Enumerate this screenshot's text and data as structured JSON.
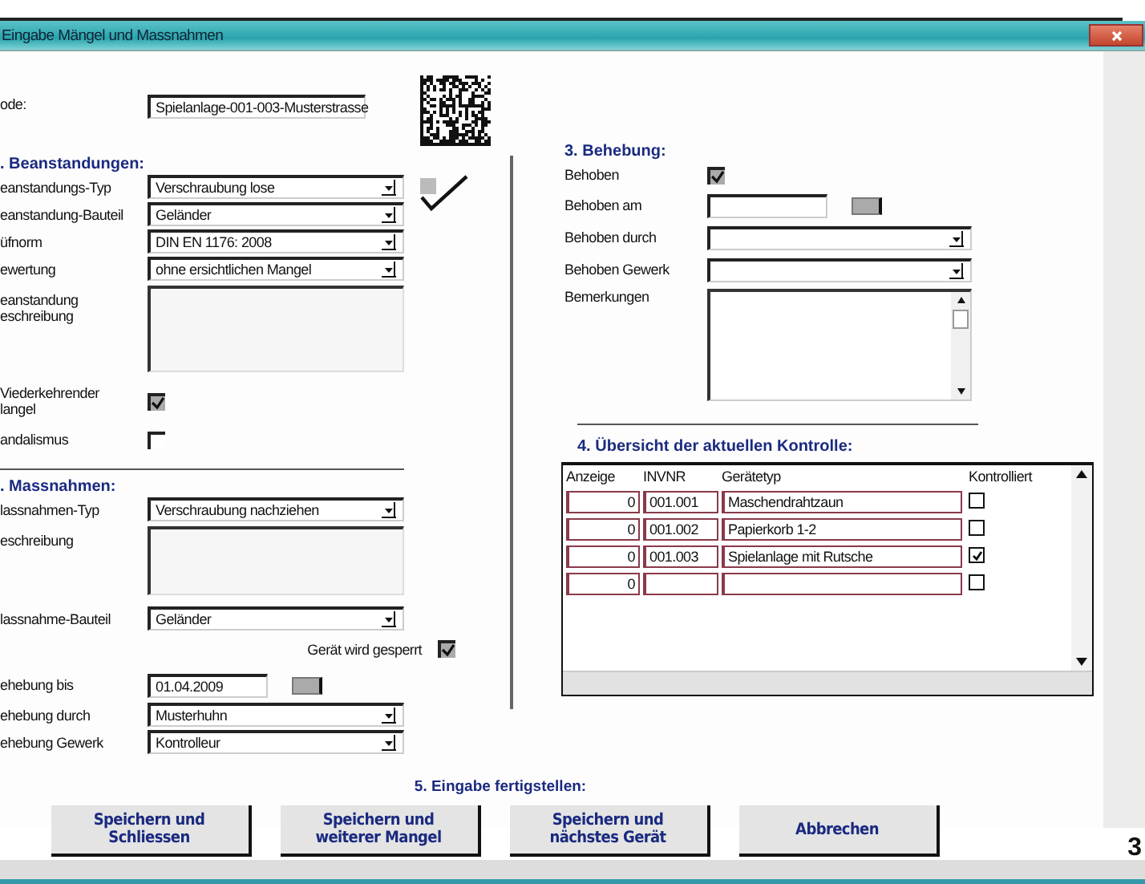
{
  "window": {
    "title": "Eingabe Mängel und Massnahmen"
  },
  "code": {
    "label": "ode:",
    "value": "Spielanlage-001-003-Musterstrasse"
  },
  "complaints": {
    "heading": ". Beanstandungen:",
    "fields": [
      {
        "kind": "dropdown",
        "label": "eanstandungs-Typ",
        "value": "Verschraubung lose"
      },
      {
        "kind": "dropdown",
        "label": "eanstandung-Bauteil",
        "value": "Geländer"
      },
      {
        "kind": "dropdown",
        "label": "üfnorm",
        "value": "DIN EN 1176: 2008"
      },
      {
        "kind": "dropdown",
        "label": "ewertung",
        "value": "ohne ersichtlichen Mangel"
      },
      {
        "kind": "textarea",
        "label": "eanstandung\neschreibung"
      },
      {
        "kind": "checkbox",
        "label": "Viederkehrender\nlangel",
        "checked": true
      },
      {
        "kind": "checkbox",
        "label": "andalismus",
        "checked": false
      }
    ]
  },
  "measures": {
    "heading": ". Massnahmen:",
    "fields": [
      {
        "kind": "dropdown",
        "label": "lassnahmen-Typ",
        "value": "Verschraubung nachziehen"
      },
      {
        "kind": "textarea",
        "label": "eschreibung"
      },
      {
        "kind": "dropdown",
        "label": "lassnahme-Bauteil",
        "value": "Geländer"
      },
      {
        "kind": "flag",
        "label": "Gerät wird gesperrt",
        "checked": true
      },
      {
        "kind": "date",
        "label": "ehebung bis",
        "value": "01.04.2009"
      },
      {
        "kind": "dropdown",
        "label": "ehebung durch",
        "value": "Musterhuhn"
      },
      {
        "kind": "dropdown",
        "label": "ehebung Gewerk",
        "value": "Kontrolleur"
      }
    ]
  },
  "repair": {
    "heading": "3. Behebung:",
    "fields": [
      {
        "kind": "checkbox",
        "label": "Behoben",
        "checked": true
      },
      {
        "kind": "date",
        "label": "Behoben am"
      },
      {
        "kind": "dropdown",
        "label": "Behoben durch"
      },
      {
        "kind": "dropdown",
        "label": "Behoben Gewerk"
      },
      {
        "kind": "memo",
        "label": "Bemerkungen"
      }
    ]
  },
  "overview": {
    "heading": "4. Übersicht der aktuellen Kontrolle:",
    "columns": [
      "Anzeige",
      "INVNR",
      "Gerätetyp",
      "Kontrolliert"
    ],
    "rows": [
      {
        "anzeige": "0",
        "invnr": "001.001",
        "geraetetyp": "Maschendrahtzaun",
        "kontrolliert": false
      },
      {
        "anzeige": "0",
        "invnr": "001.002",
        "geraetetyp": "Papierkorb 1-2",
        "kontrolliert": false
      },
      {
        "anzeige": "0",
        "invnr": "001.003",
        "geraetetyp": "Spielanlage mit Rutsche",
        "kontrolliert": true
      },
      {
        "anzeige": "0",
        "kontrolliert": false
      }
    ]
  },
  "finish": {
    "heading": "5. Eingabe fertigstellen:",
    "buttons": [
      "Speichern und\nSchliessen",
      "Speichern und\nweiterer Mangel",
      "Speichern und\nnächstes Gerät",
      "Abbrechen"
    ]
  },
  "page_number": "3"
}
